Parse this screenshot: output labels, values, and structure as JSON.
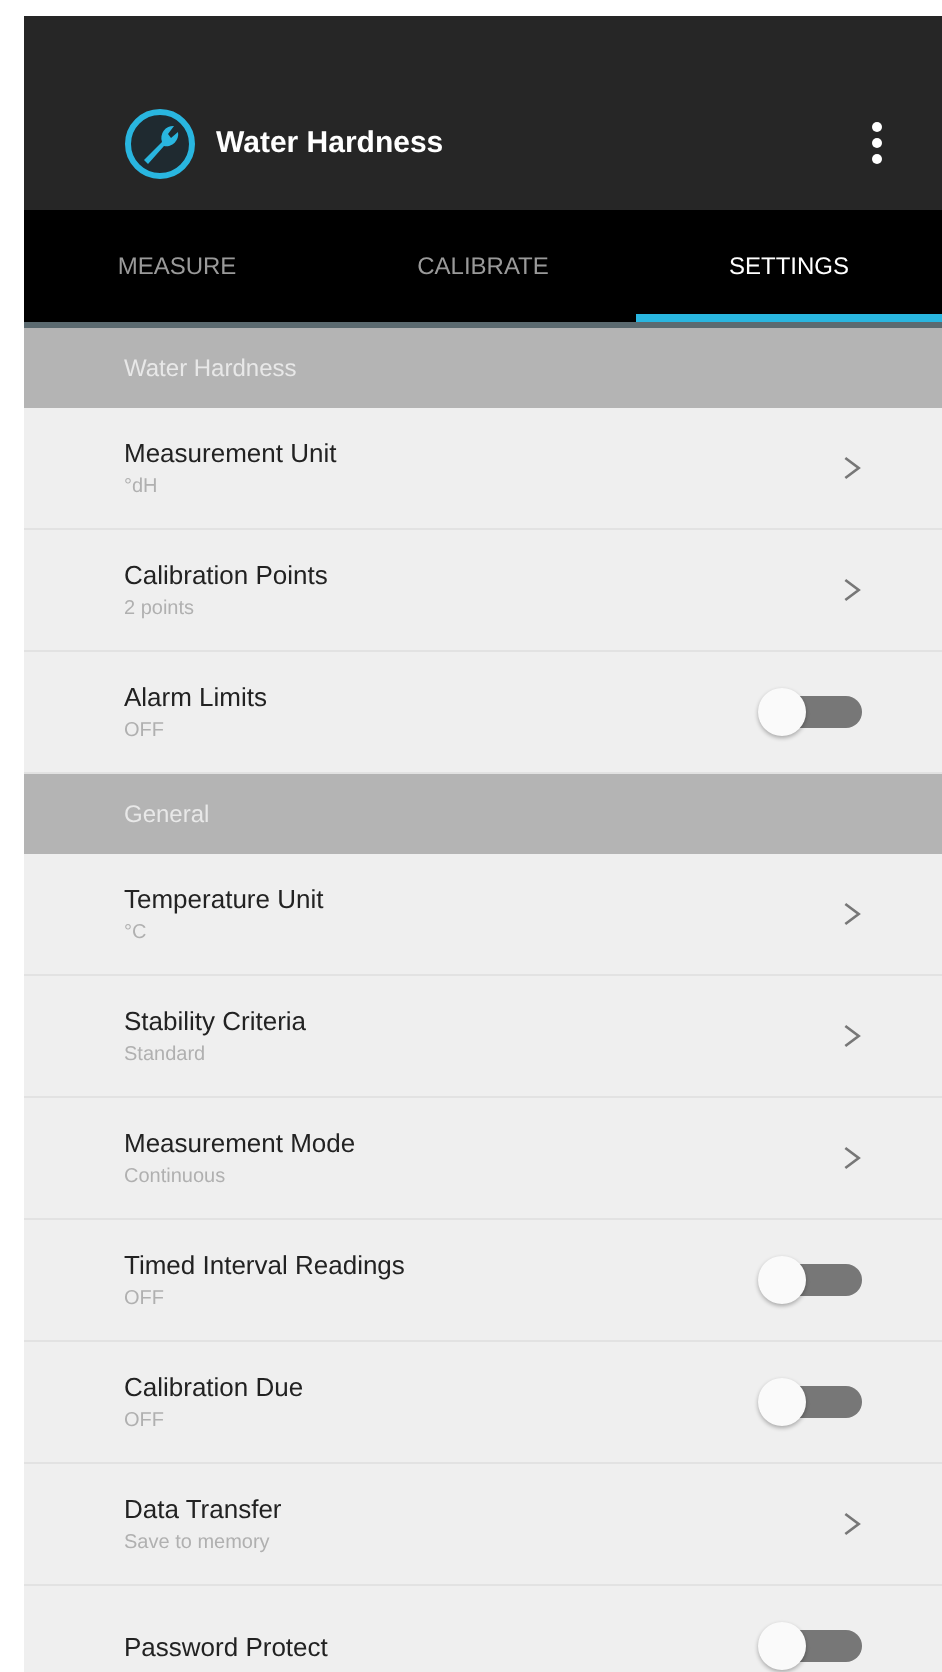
{
  "app_bar": {
    "title": "Water Hardness"
  },
  "tabs": [
    {
      "label": "MEASURE",
      "selected": false
    },
    {
      "label": "CALIBRATE",
      "selected": false
    },
    {
      "label": "SETTINGS",
      "selected": true
    }
  ],
  "sections": [
    {
      "header": "Water Hardness",
      "items": [
        {
          "kind": "link",
          "title": "Measurement Unit",
          "subtitle": "°dH"
        },
        {
          "kind": "link",
          "title": "Calibration Points",
          "subtitle": "2 points"
        },
        {
          "kind": "toggle",
          "title": "Alarm Limits",
          "subtitle": "OFF",
          "on": false
        }
      ]
    },
    {
      "header": "General",
      "items": [
        {
          "kind": "link",
          "title": "Temperature Unit",
          "subtitle": "°C"
        },
        {
          "kind": "link",
          "title": "Stability Criteria",
          "subtitle": "Standard"
        },
        {
          "kind": "link",
          "title": "Measurement Mode",
          "subtitle": "Continuous"
        },
        {
          "kind": "toggle",
          "title": "Timed Interval Readings",
          "subtitle": "OFF",
          "on": false
        },
        {
          "kind": "toggle",
          "title": "Calibration Due",
          "subtitle": "OFF",
          "on": false
        },
        {
          "kind": "link",
          "title": "Data Transfer",
          "subtitle": "Save to memory"
        },
        {
          "kind": "toggle",
          "title": "Password Protect",
          "on": false
        }
      ]
    }
  ]
}
